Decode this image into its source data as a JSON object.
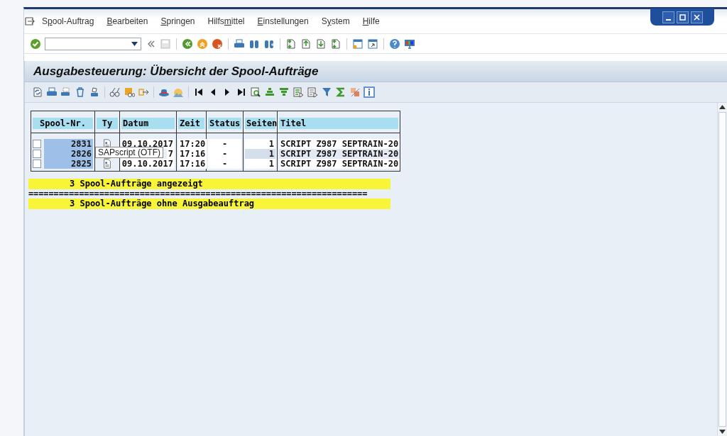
{
  "menu": [
    {
      "before": "S",
      "mnemonic": "p",
      "after": "ool-Auftrag"
    },
    {
      "mnemonic": "B",
      "after": "earbeiten"
    },
    {
      "mnemonic": "S",
      "after": "pringen"
    },
    {
      "before": "Hilfs",
      "mnemonic": "m",
      "after": "ittel"
    },
    {
      "mnemonic": "E",
      "after": "instellungen"
    },
    {
      "before": "S",
      "mnemonic": "y",
      "after": "stem"
    },
    {
      "mnemonic": "H",
      "after": "ilfe"
    }
  ],
  "title": "Ausgabesteuerung: Übersicht der Spool-Aufträge",
  "table": {
    "columns": [
      "Spool-Nr.",
      "Ty",
      "Datum",
      "Zeit",
      "Status",
      "Seiten",
      "Titel"
    ],
    "rows": [
      {
        "checked": false,
        "highlighted": false,
        "spool_nr": "2831",
        "date": "09.10.2017",
        "time": "17:20",
        "status": "-",
        "pages": "1",
        "title": "SCRIPT Z987 SEPTRAIN-20"
      },
      {
        "checked": false,
        "highlighted": true,
        "spool_nr": "2826",
        "date": "7",
        "time": "17:16",
        "status": "-",
        "pages": "1",
        "title": "SCRIPT Z987 SEPTRAIN-20"
      },
      {
        "checked": false,
        "highlighted": false,
        "spool_nr": "2825",
        "date": "09.10.2017",
        "time": "17:16",
        "status": "-",
        "pages": "1",
        "title": "SCRIPT Z987 SEPTRAIN-20"
      }
    ]
  },
  "tooltip": "SAPscript (OTF)",
  "summary": [
    "3 Spool-Aufträge angezeigt",
    "===================================================================",
    "3 Spool-Aufträge ohne Ausgabeauftrag"
  ]
}
